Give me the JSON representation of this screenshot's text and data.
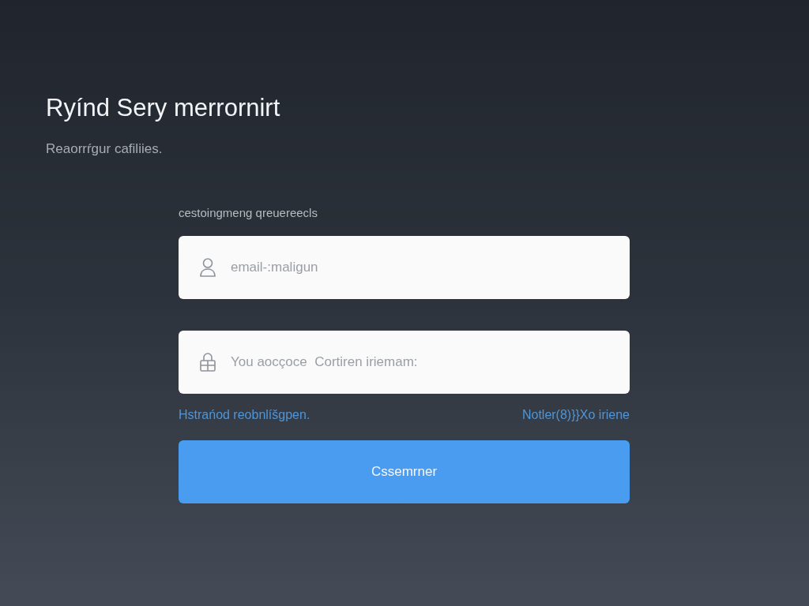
{
  "title": "Ryínd Sery merrornirt",
  "subtitle": "Reaorrŕgur cafiliies.",
  "form": {
    "label": "cestoingmeng qreuereecls",
    "fields": [
      {
        "kind": "user",
        "placeholder": "email-:maligun"
      },
      {
        "kind": "lock",
        "placeholder": "You aocçoce  Cortiren iriemam:"
      }
    ],
    "links": [
      "Hstrańod reobnlíšgpen.",
      "Notler(8)}}Xo iriene"
    ],
    "submit": "Cssemrner"
  }
}
